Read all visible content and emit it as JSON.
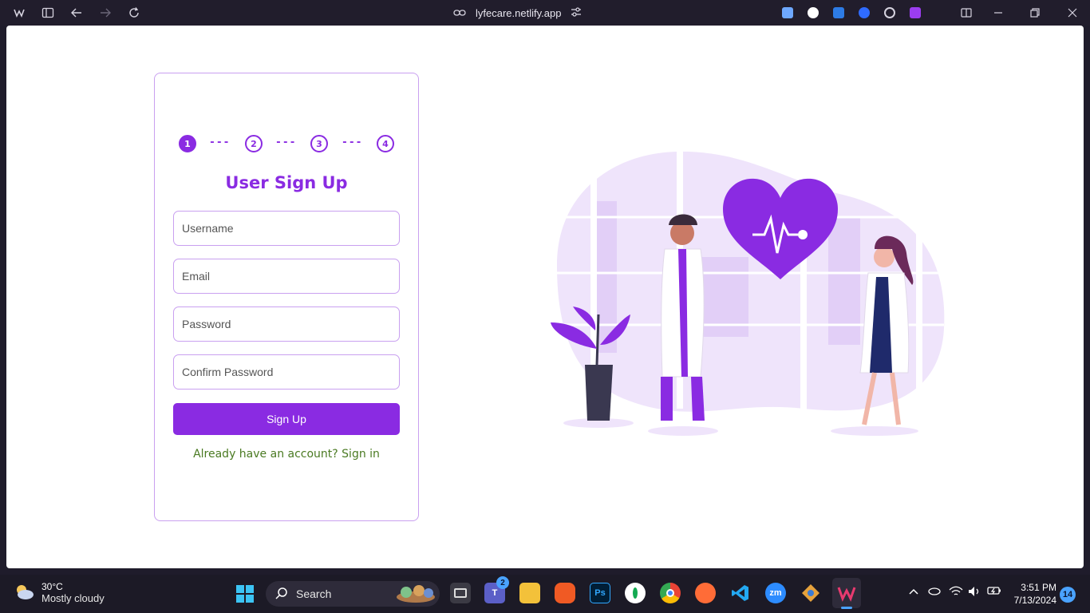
{
  "browser": {
    "url": "lyfecare.netlify.app",
    "extensions": [
      "doc-extension",
      "w-extension",
      "office-extension",
      "blue-extension",
      "target-extension",
      "purple-extension"
    ]
  },
  "signup": {
    "steps": [
      "1",
      "2",
      "3",
      "4"
    ],
    "step_separator": "---",
    "active_step": 1,
    "title": "User Sign Up",
    "username_placeholder": "Username",
    "email_placeholder": "Email",
    "password_placeholder": "Password",
    "confirm_password_placeholder": "Confirm Password",
    "submit_label": "Sign Up",
    "signin_text": "Already have an account? Sign in",
    "accent_color": "#8a2be2"
  },
  "taskbar": {
    "temperature": "30°C",
    "weather": "Mostly cloudy",
    "search_label": "Search",
    "teams_badge": "2",
    "ps_label": "Ps",
    "zoom_label": "zm",
    "time": "3:51 PM",
    "date": "7/13/2024",
    "notification_count": "14"
  }
}
